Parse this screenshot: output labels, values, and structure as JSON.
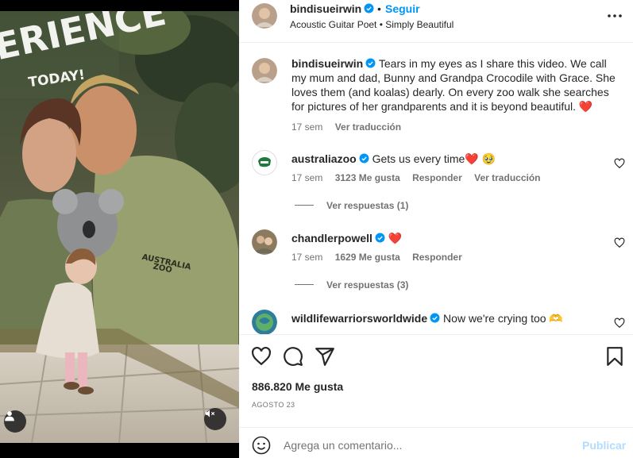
{
  "media": {
    "poster_text_lines": [
      "EXPERIENCE",
      "TODAY!"
    ],
    "shirt_text_lines": [
      "AUSTRALIA",
      "ZOO"
    ],
    "user_icon": "person-icon",
    "mute_icon": "speaker-muted-icon"
  },
  "header": {
    "username": "bindisueirwin",
    "separator": "•",
    "follow_label": "Seguir",
    "subtitle": "Acoustic Guitar Poet • Simply Beautiful",
    "more_icon": "ellipsis-icon"
  },
  "caption": {
    "username": "bindisueirwin",
    "text": "Tears in my eyes as I share this video. We call my mum and dad, Bunny and Grandpa Crocodile with Grace. She loves them (and koalas) dearly. On every zoo walk she searches for pictures of her grandparents and it is beyond beautiful. ❤️",
    "time": "17 sem",
    "translate": "Ver traducción"
  },
  "comments": [
    {
      "username": "australiazoo",
      "text": "Gets us every time❤️ 🥹",
      "time": "17 sem",
      "likes": "3123 Me gusta",
      "reply": "Responder",
      "translate": "Ver traducción",
      "replies": "Ver respuestas (1)"
    },
    {
      "username": "chandlerpowell",
      "text": "❤️",
      "time": "17 sem",
      "likes": "1629 Me gusta",
      "reply": "Responder",
      "replies": "Ver respuestas (3)"
    },
    {
      "username": "wildlifewarriorsworldwide",
      "text": "Now we're crying too 🫶"
    }
  ],
  "actions": {
    "like_icon": "heart-icon",
    "comment_icon": "comment-bubble-icon",
    "share_icon": "paper-plane-icon",
    "save_icon": "bookmark-icon",
    "likes": "886.820 Me gusta",
    "date": "AGOSTO 23"
  },
  "composer": {
    "placeholder": "Agrega un comentario...",
    "publish_label": "Publicar",
    "emoji_icon": "smiley-icon"
  },
  "colors": {
    "link_blue": "#0095f6",
    "publish_disabled": "#b3dbff",
    "heart_red": "#ed4956",
    "secondary_text": "#737373"
  }
}
